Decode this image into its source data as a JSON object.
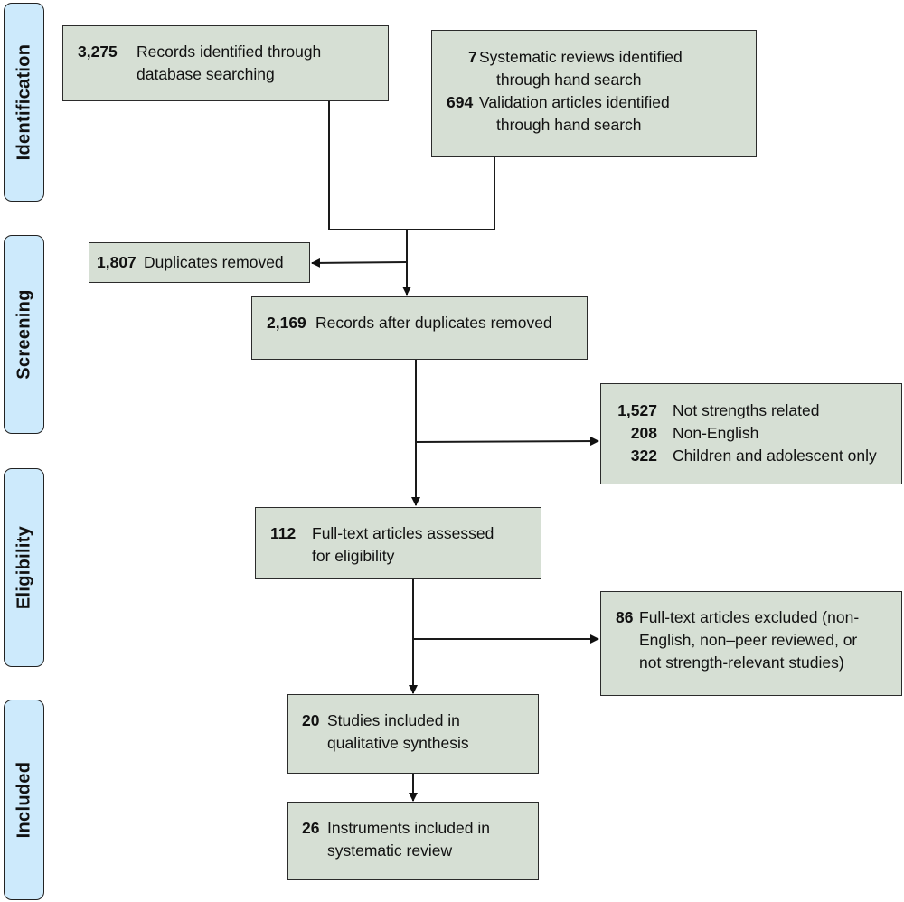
{
  "phases": [
    {
      "label": "Identification"
    },
    {
      "label": "Screening"
    },
    {
      "label": "Eligibility"
    },
    {
      "label": "Included"
    }
  ],
  "boxes": {
    "database_search": {
      "count": "3,275",
      "text_line1": "Records identified through",
      "text_line2": "database searching"
    },
    "hand_search": {
      "items": [
        {
          "count": "7",
          "text_line1": "Systematic reviews identified",
          "text_line2": "through hand search"
        },
        {
          "count": "694",
          "text_line1": "Validation articles identified",
          "text_line2": "through hand search"
        }
      ]
    },
    "duplicates_removed": {
      "count": "1,807",
      "text": "Duplicates removed"
    },
    "after_duplicates": {
      "count": "2,169",
      "text": "Records after duplicates removed"
    },
    "screen_excluded": {
      "items": [
        {
          "count": "1,527",
          "text": "Not strengths related"
        },
        {
          "count": "208",
          "text": "Non-English"
        },
        {
          "count": "322",
          "text": "Children and adolescent only"
        }
      ]
    },
    "full_text_assessed": {
      "count": "112",
      "text_line1": "Full-text articles assessed",
      "text_line2": "for eligibility"
    },
    "full_text_excluded": {
      "count": "86",
      "text_line1": "Full-text articles excluded (non-",
      "text_line2": "English, non–peer reviewed, or",
      "text_line3": "not strength-relevant studies)"
    },
    "qualitative_synthesis": {
      "count": "20",
      "text_line1": "Studies included in",
      "text_line2": "qualitative synthesis"
    },
    "systematic_review": {
      "count": "26",
      "text_line1": "Instruments included in",
      "text_line2": "systematic review"
    }
  },
  "colors": {
    "box_fill": "#d6dfd4",
    "phase_fill": "#cdeafc",
    "stroke": "#222222"
  }
}
